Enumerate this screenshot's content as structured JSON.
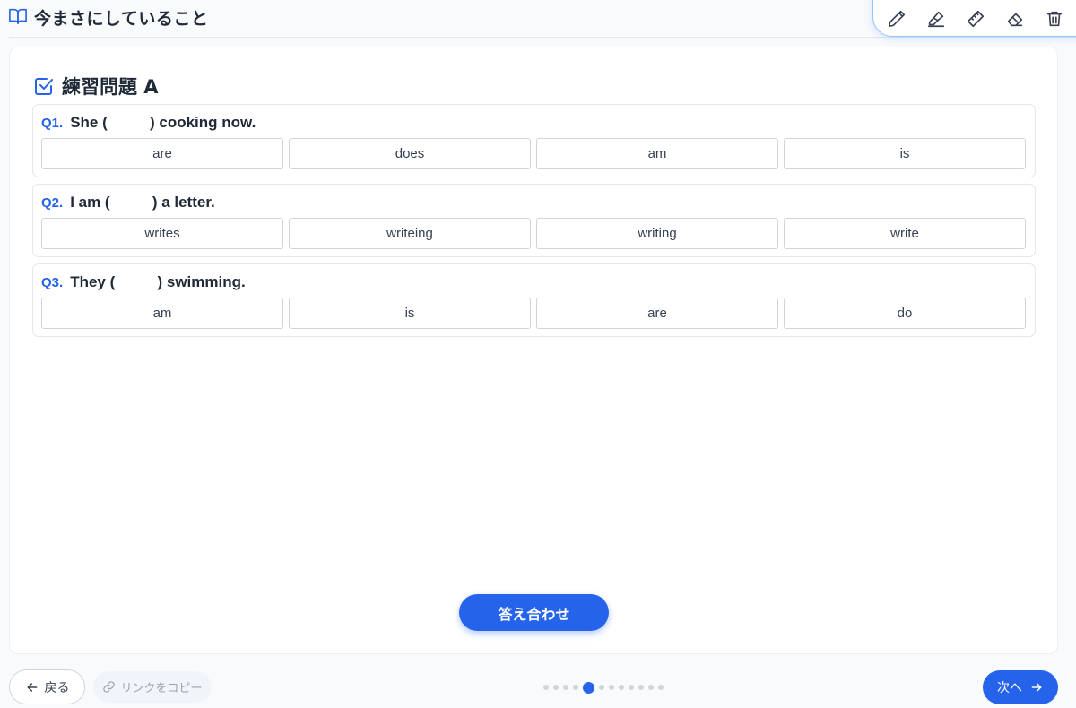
{
  "header": {
    "title": "今まさにしていること",
    "icon": "book-open-icon"
  },
  "toolbar": {
    "tools": [
      "pencil-icon",
      "highlighter-icon",
      "ruler-icon",
      "eraser-icon",
      "trash-icon"
    ]
  },
  "exercise": {
    "title": "練習問題 A",
    "questions": [
      {
        "number": "Q1.",
        "text": "She (          ) cooking now.",
        "options": [
          "are",
          "does",
          "am",
          "is"
        ]
      },
      {
        "number": "Q2.",
        "text": "I am (          ) a letter.",
        "options": [
          "writes",
          "writeing",
          "writing",
          "write"
        ]
      },
      {
        "number": "Q3.",
        "text": "They (          ) swimming.",
        "options": [
          "am",
          "is",
          "are",
          "do"
        ]
      }
    ],
    "check_label": "答え合わせ"
  },
  "footer": {
    "back_label": "戻る",
    "copy_label": "リンクをコピー",
    "next_label": "次へ",
    "pagination": {
      "total": 12,
      "current": 5
    }
  },
  "colors": {
    "accent": "#2563eb"
  }
}
